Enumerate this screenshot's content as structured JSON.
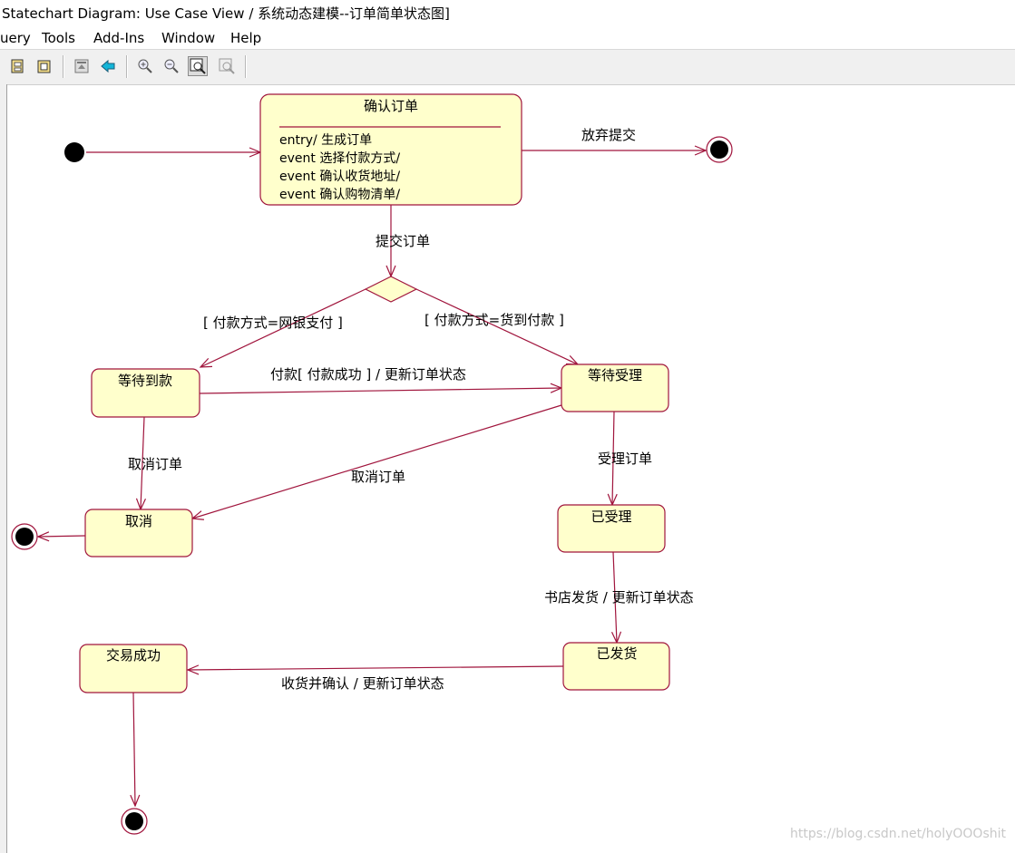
{
  "window": {
    "title": "Statechart Diagram: Use Case View / 系统动态建模--订单简单状态图]"
  },
  "menu": [
    "uery",
    "Tools",
    "Add-Ins",
    "Window",
    "Help"
  ],
  "toolbar_icons": [
    "browse-diagram-icon",
    "window-icon",
    "browse-parent-icon",
    "previous-diagram-icon",
    "zoom-in-icon",
    "zoom-out-icon",
    "fit-in-window-icon",
    "undo-fit-icon"
  ],
  "colors": {
    "state_fill": "#ffffcc",
    "border": "#a0143c",
    "toolbar_bg": "#f0f0f0"
  },
  "diagram": {
    "states": {
      "confirm_order": {
        "name": "确认订单",
        "actions": [
          "entry/ 生成订单",
          "event 选择付款方式/",
          "event 确认收货地址/",
          "event 确认购物清单/"
        ]
      },
      "awaiting_payment": {
        "name": "等待到款"
      },
      "awaiting_acceptance": {
        "name": "等待受理"
      },
      "cancelled": {
        "name": "取消"
      },
      "accepted": {
        "name": "已受理"
      },
      "shipped": {
        "name": "已发货"
      },
      "completed": {
        "name": "交易成功"
      }
    },
    "transitions": {
      "abandon": "放弃提交",
      "submit": "提交订单",
      "guard_online": "[ 付款方式=网银支付 ]",
      "guard_cod": "[ 付款方式=货到付款 ]",
      "pay": "付款[ 付款成功 ] / 更新订单状态",
      "cancel_1": "取消订单",
      "cancel_2": "取消订单",
      "accept": "受理订单",
      "ship": "书店发货 / 更新订单状态",
      "receive": "收货并确认 / 更新订单状态"
    }
  },
  "watermark": "https://blog.csdn.net/holyOOOshit"
}
